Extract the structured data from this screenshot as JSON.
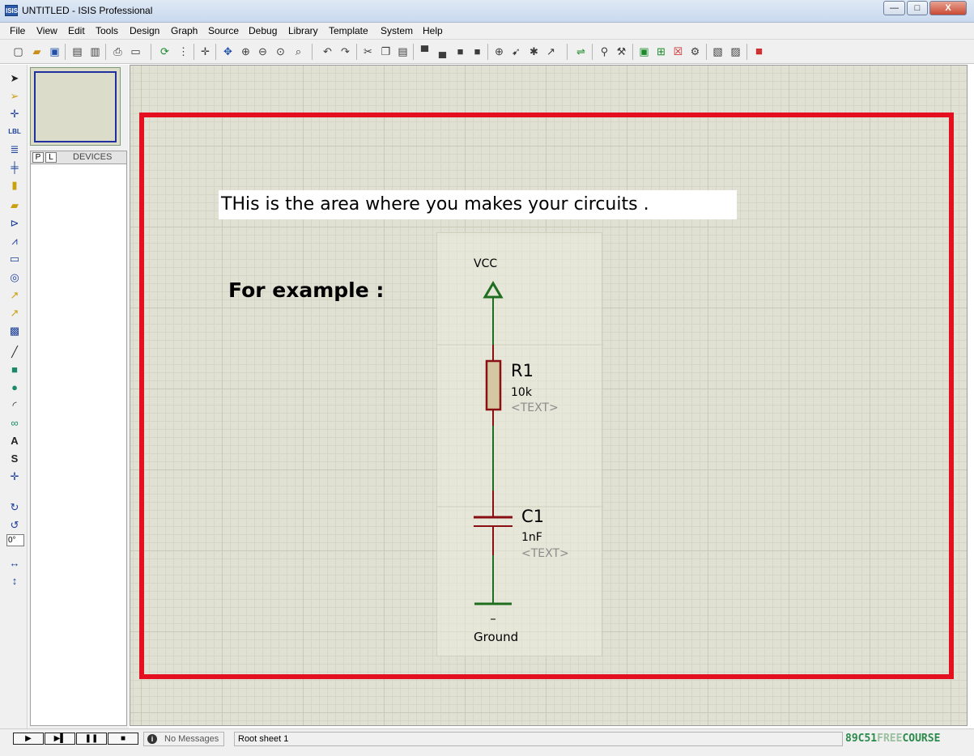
{
  "window": {
    "title": "UNTITLED - ISIS Professional",
    "app_icon": "ISIS",
    "minimize_label": "—",
    "maximize_label": "□",
    "close_label": "X"
  },
  "menu": [
    "File",
    "View",
    "Edit",
    "Tools",
    "Design",
    "Graph",
    "Source",
    "Debug",
    "Library",
    "Template",
    "System",
    "Help"
  ],
  "toolbar_icons": [
    "new-icon",
    "open-icon",
    "save-icon",
    "import-icon",
    "export-icon",
    "print-icon",
    "print-area-icon",
    "refresh-icon",
    "grid-icon",
    "origin-icon",
    "pan-icon",
    "zoom-in-icon",
    "zoom-out-icon",
    "zoom-all-icon",
    "zoom-area-icon",
    "undo-icon",
    "redo-icon",
    "cut-icon",
    "copy-icon",
    "paste-icon",
    "block-copy-icon",
    "block-move-icon",
    "block-rotate-icon",
    "block-delete-icon",
    "pick-device-icon",
    "make-device-icon",
    "packaging-icon",
    "decompose-icon",
    "wire-autoroute-icon",
    "search-icon",
    "property-tool-icon",
    "new-sheet-icon",
    "add-sheet-icon",
    "remove-sheet-icon",
    "netlist-icon",
    "bom-icon",
    "erc-icon",
    "ares-icon"
  ],
  "left_tools": [
    "selection-mode-icon",
    "component-mode-icon",
    "junction-dot-icon",
    "wire-label-icon",
    "text-script-icon",
    "bus-icon",
    "subcircuit-icon",
    "terminal-icon",
    "device-pin-icon",
    "graph-icon",
    "tape-recorder-icon",
    "generator-icon",
    "voltage-probe-icon",
    "current-probe-icon",
    "virtual-instrument-icon",
    "line-icon",
    "box-icon",
    "circle-icon",
    "arc-icon",
    "path-icon",
    "text-icon",
    "symbol-icon",
    "marker-icon",
    "rotate-clockwise-icon",
    "rotate-anticlockwise-icon",
    "flip-horizontal-icon",
    "flip-vertical-icon"
  ],
  "rotation": {
    "value": "0°"
  },
  "devices_panel": {
    "p_label": "P",
    "l_label": "L",
    "title": "DEVICES"
  },
  "canvas": {
    "callout": "THis is the area where you makes your circuits .",
    "example_label": "For example :"
  },
  "schematic": {
    "power": "VCC",
    "resistor": {
      "ref": "R1",
      "value": "10k",
      "text": "<TEXT>"
    },
    "capacitor": {
      "ref": "C1",
      "value": "1nF",
      "text": "<TEXT>"
    },
    "ground": "Ground",
    "colors": {
      "wire": "#1f6d1f",
      "component": "#8a0f12",
      "body_fill": "#d4c8a3"
    }
  },
  "statusbar": {
    "play_label": "▶",
    "step_label": "▶▌",
    "pause_label": "❚❚",
    "stop_label": "■",
    "messages": "No Messages",
    "sheet": "Root sheet 1",
    "brand_a": "89C51",
    "brand_b": "FREE",
    "brand_c": "COURSE"
  }
}
